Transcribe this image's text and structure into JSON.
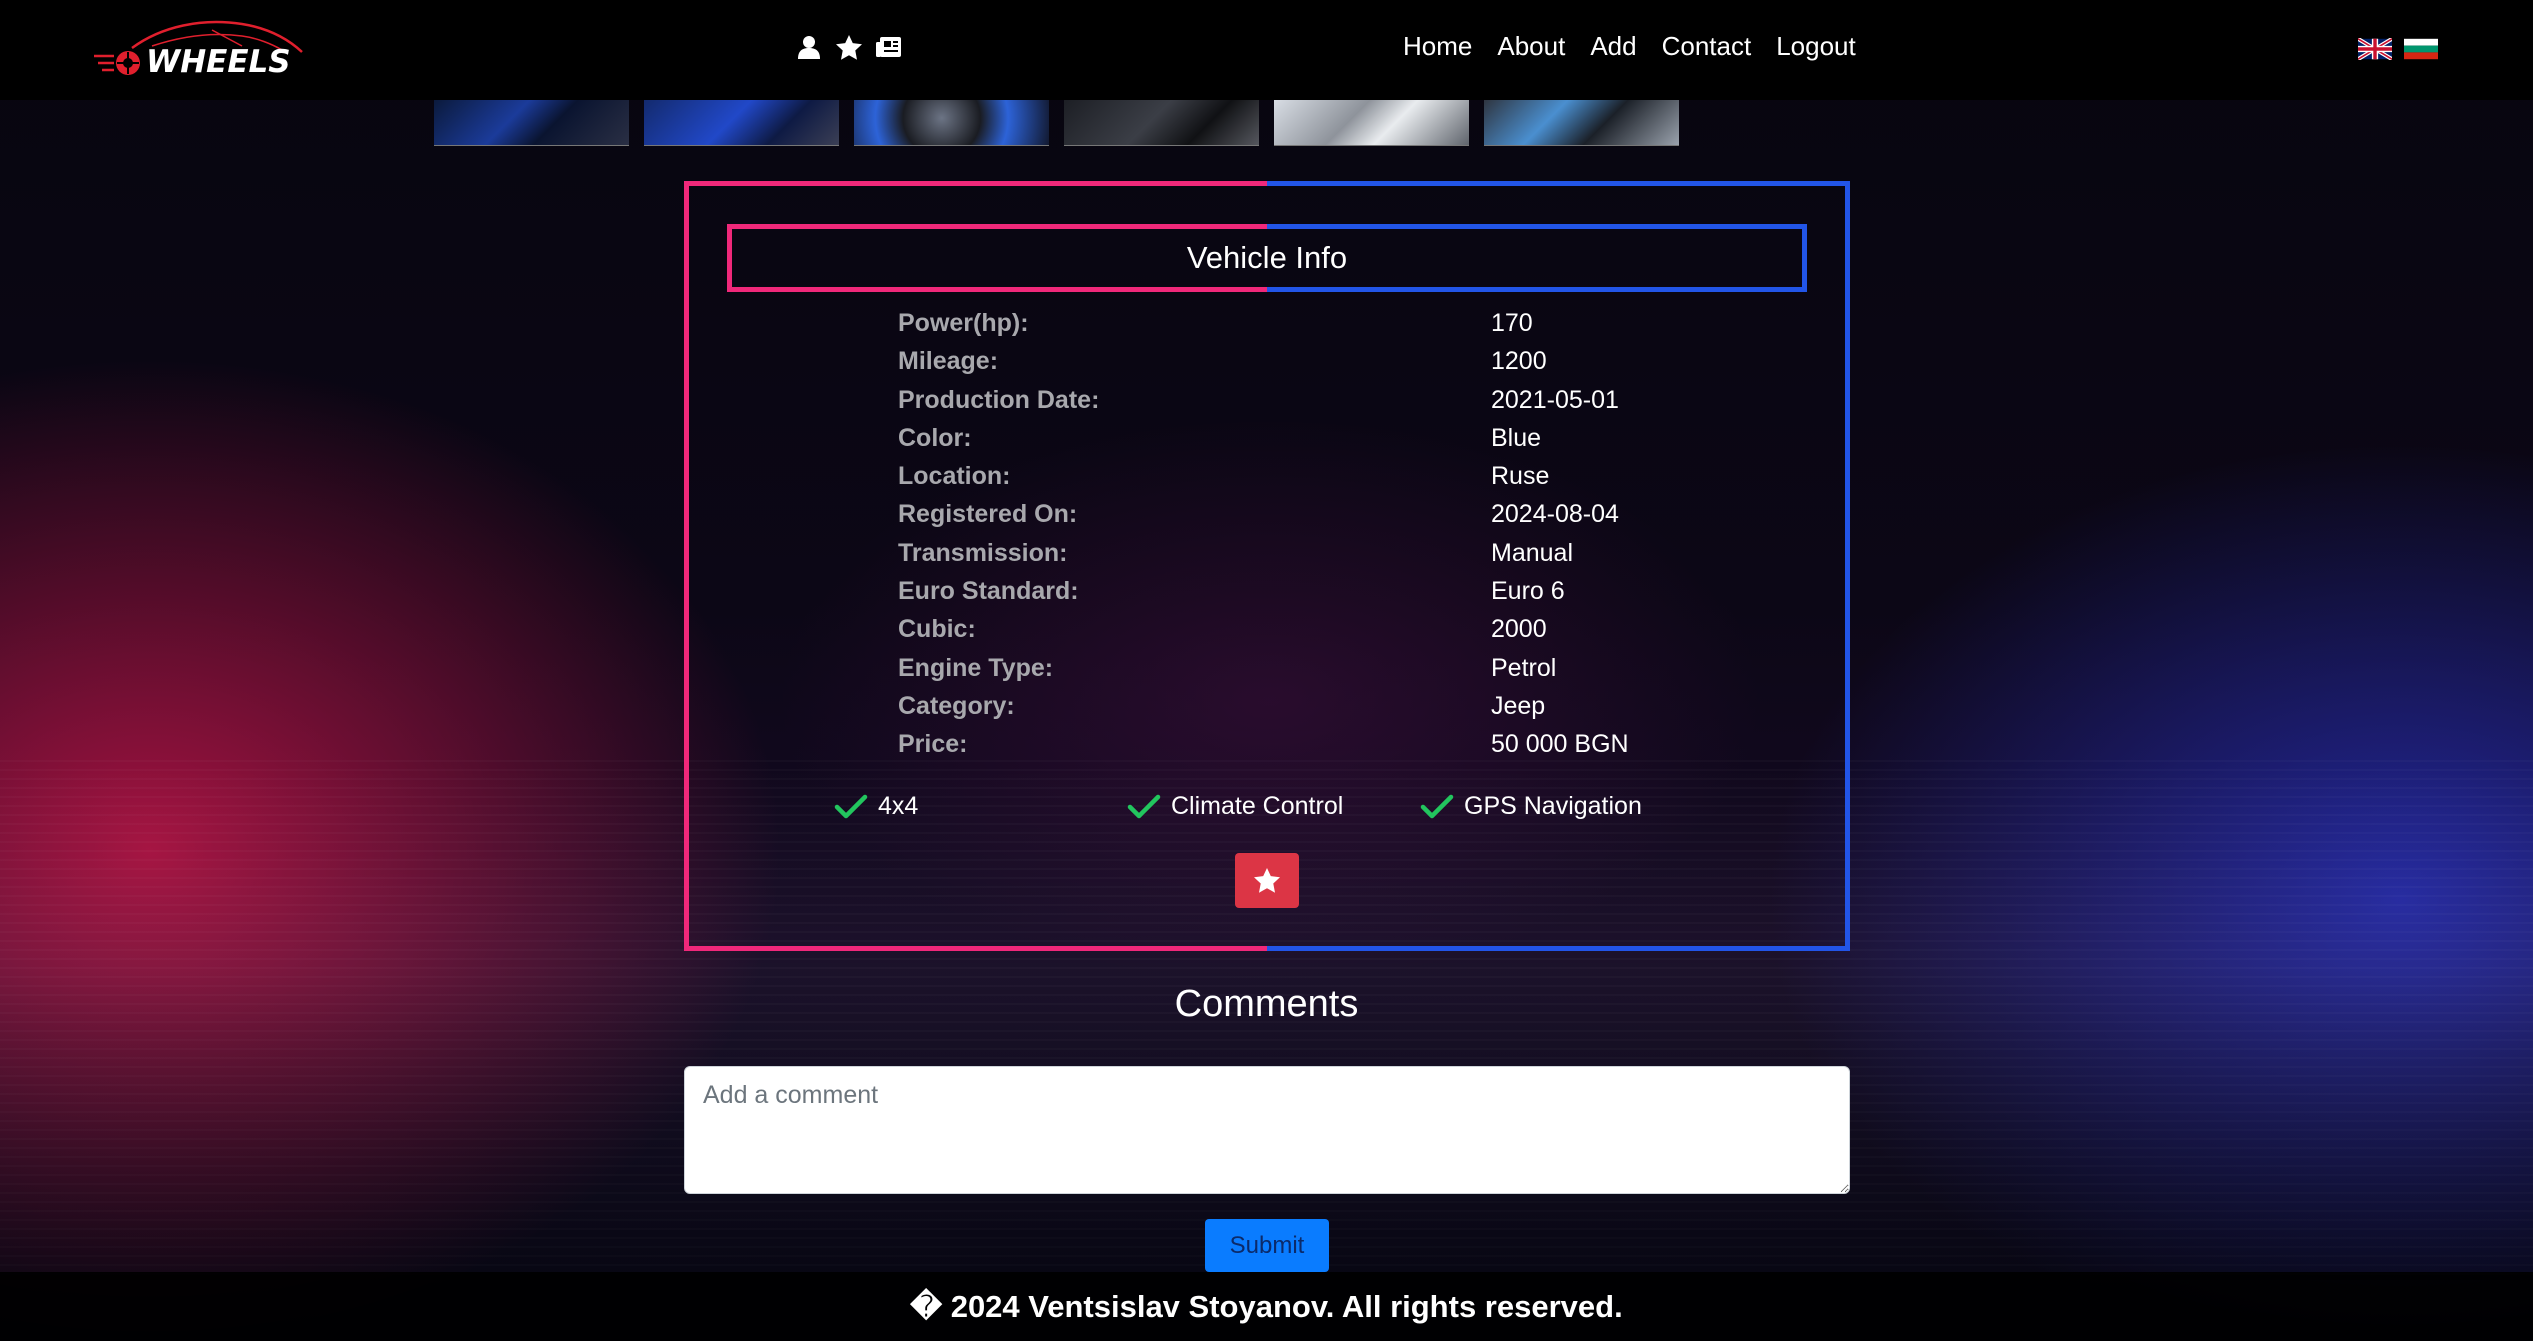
{
  "navbar": {
    "brand": "WHEELS",
    "icons": [
      "user-icon",
      "star-icon",
      "newspaper-icon"
    ],
    "links": [
      "Home",
      "About",
      "Add",
      "Contact",
      "Logout"
    ],
    "languages": [
      "English",
      "Bulgarian"
    ]
  },
  "gallery": {
    "thumbnail_count": 6
  },
  "vehicle_info": {
    "title": "Vehicle Info",
    "specs": [
      {
        "label": "Power(hp):",
        "value": "170"
      },
      {
        "label": "Mileage:",
        "value": "1200"
      },
      {
        "label": "Production Date:",
        "value": "2021-05-01"
      },
      {
        "label": "Color:",
        "value": "Blue"
      },
      {
        "label": "Location:",
        "value": "Ruse"
      },
      {
        "label": "Registered On:",
        "value": "2024-08-04"
      },
      {
        "label": "Transmission:",
        "value": "Manual"
      },
      {
        "label": "Euro Standard:",
        "value": "Euro 6"
      },
      {
        "label": "Cubic:",
        "value": "2000"
      },
      {
        "label": "Engine Type:",
        "value": "Petrol"
      },
      {
        "label": "Category:",
        "value": "Jeep"
      },
      {
        "label": "Price:",
        "value": "50 000 BGN"
      }
    ],
    "features": [
      "4x4",
      "Climate Control",
      "GPS Navigation"
    ],
    "favorite_button_icon": "star-icon"
  },
  "comments": {
    "title": "Comments",
    "placeholder": "Add a comment",
    "value": "",
    "submit_label": "Submit"
  },
  "footer": {
    "text": "� 2024 Ventsislav Stoyanov. All rights reserved."
  },
  "colors": {
    "accent_pink": "#f0287a",
    "accent_blue": "#2255e8",
    "favorite_red": "#dc3545",
    "submit_blue": "#0a7cff",
    "check_green": "#22c55e"
  }
}
